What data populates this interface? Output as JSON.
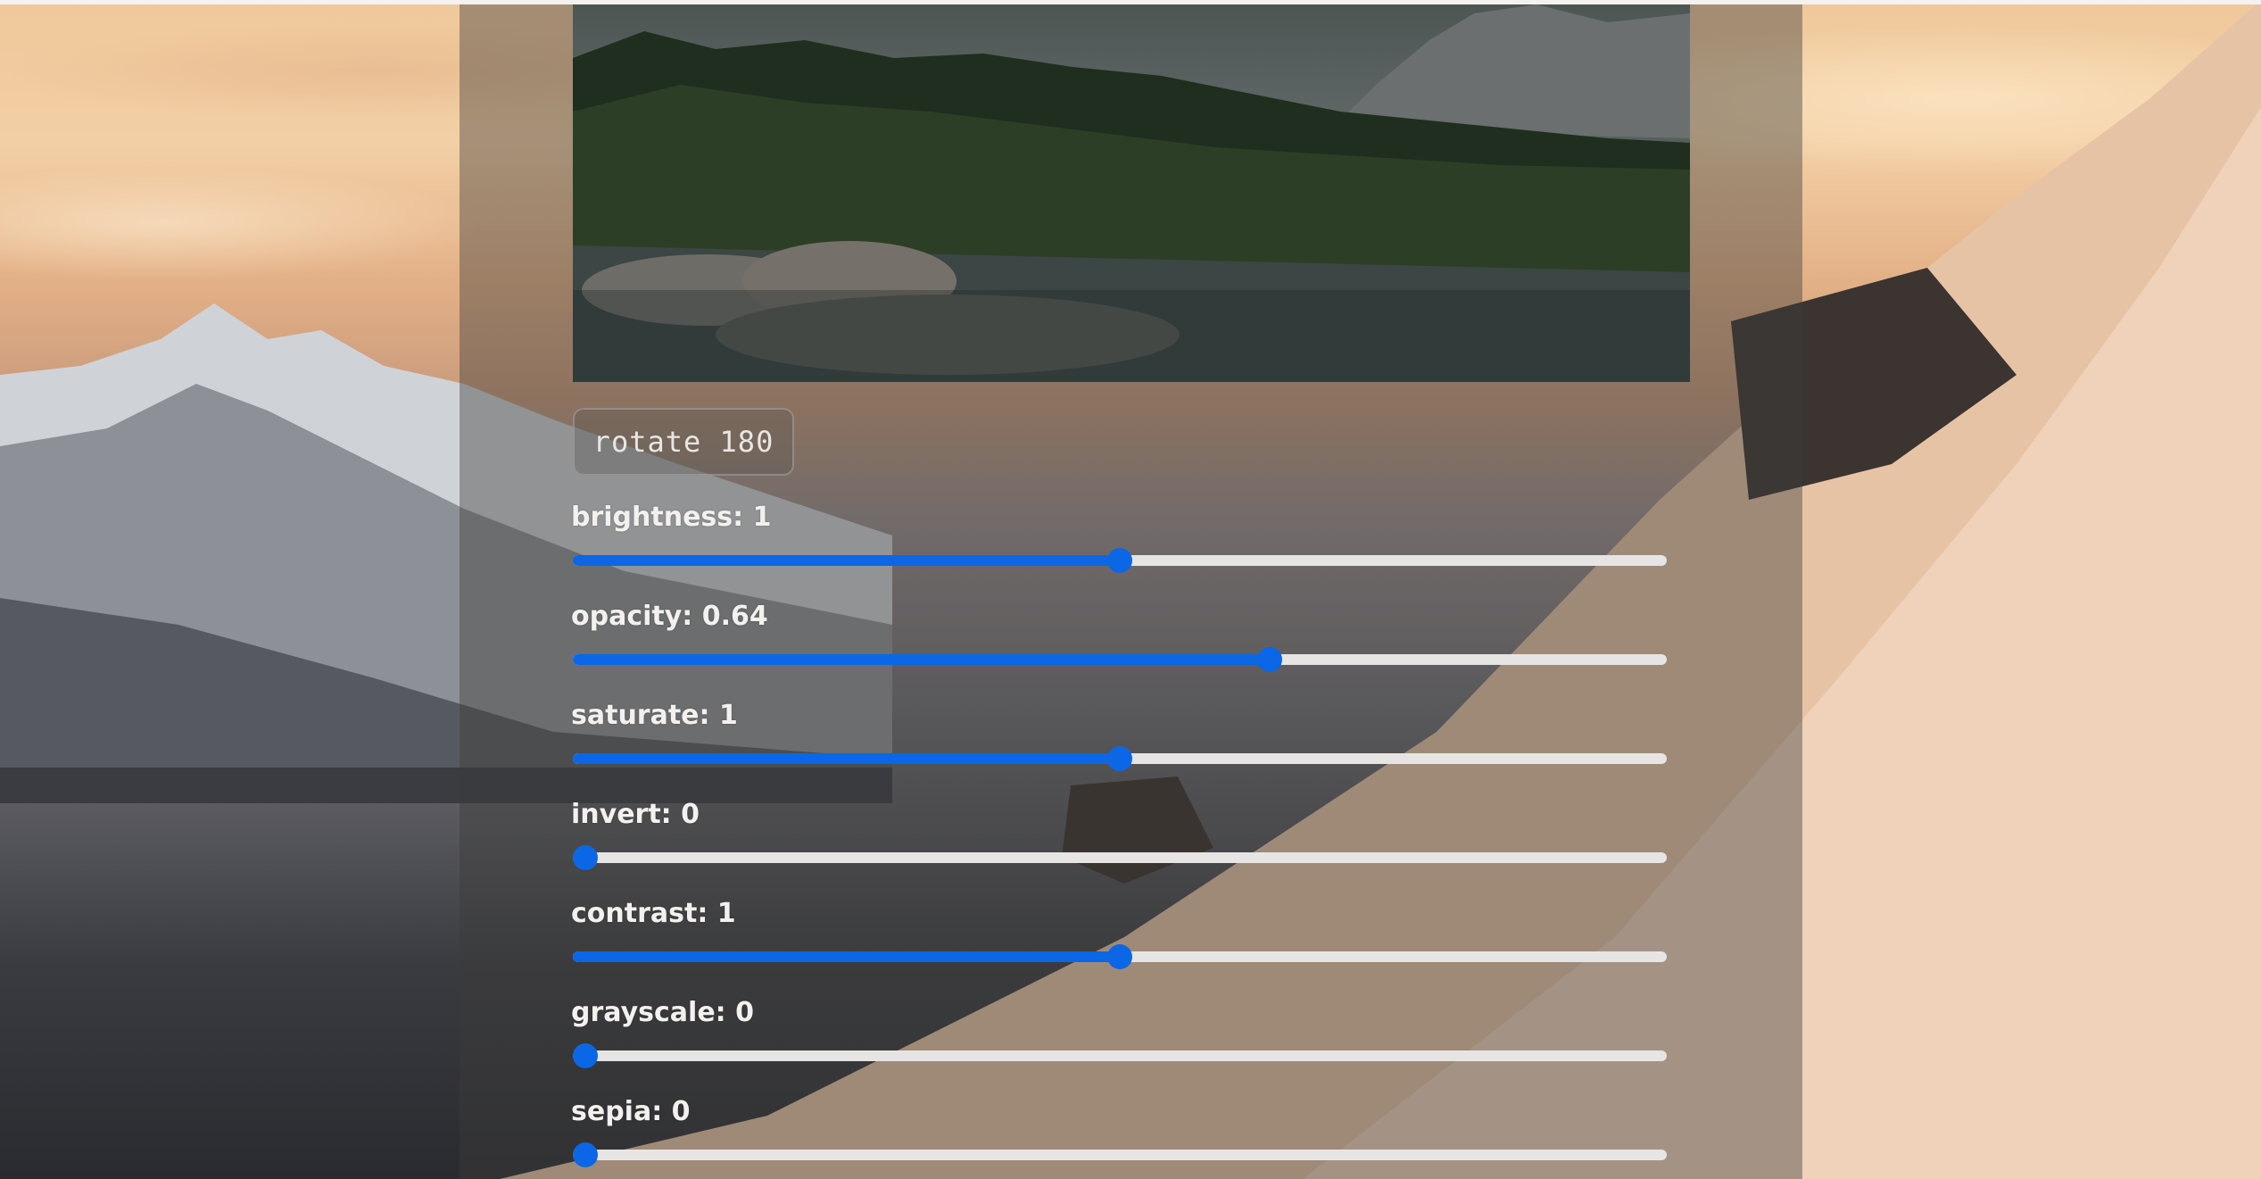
{
  "controls": {
    "rotate_label": "rotate 180",
    "sliders": [
      {
        "key": "brightness",
        "label": "brightness: 1",
        "fraction": 0.5
      },
      {
        "key": "opacity",
        "label": "opacity: 0.64",
        "fraction": 0.64
      },
      {
        "key": "saturate",
        "label": "saturate: 1",
        "fraction": 0.5
      },
      {
        "key": "invert",
        "label": "invert: 0",
        "fraction": 0
      },
      {
        "key": "contrast",
        "label": "contrast: 1",
        "fraction": 0.5
      },
      {
        "key": "grayscale",
        "label": "grayscale: 0",
        "fraction": 0
      },
      {
        "key": "sepia",
        "label": "sepia: 0",
        "fraction": 0
      }
    ]
  },
  "colors": {
    "accent": "#0b67e6",
    "track": "#e7e5e3",
    "label_text": "#f3f1ee"
  }
}
